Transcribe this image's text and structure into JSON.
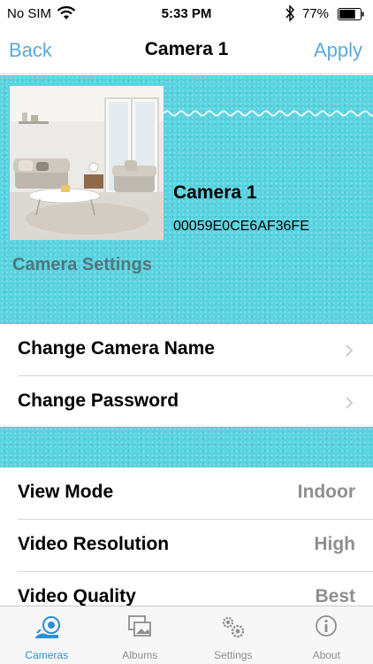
{
  "status_bar": {
    "carrier": "No SIM",
    "time": "5:33 PM",
    "battery": "77%",
    "battery_level": 0.77
  },
  "nav": {
    "back": "Back",
    "title": "Camera 1",
    "apply": "Apply"
  },
  "camera": {
    "name": "Camera 1",
    "id": "00059E0CE6AF36FE",
    "section_title": "Camera Settings"
  },
  "actions": [
    {
      "label": "Change Camera Name"
    },
    {
      "label": "Change Password"
    }
  ],
  "settings": [
    {
      "label": "View Mode",
      "value": "Indoor"
    },
    {
      "label": "Video Resolution",
      "value": "High"
    },
    {
      "label": "Video Quality",
      "value": "Best"
    }
  ],
  "tabs": [
    {
      "label": "Cameras",
      "icon": "camera-icon",
      "active": true
    },
    {
      "label": "Albums",
      "icon": "albums-icon",
      "active": false
    },
    {
      "label": "Settings",
      "icon": "gears-icon",
      "active": false
    },
    {
      "label": "About",
      "icon": "info-icon",
      "active": false
    }
  ],
  "colors": {
    "accent": "#5ba9d8",
    "teal_background": "#58d3e0",
    "section_title": "#50767c",
    "active_tab": "#2b8fd4"
  }
}
